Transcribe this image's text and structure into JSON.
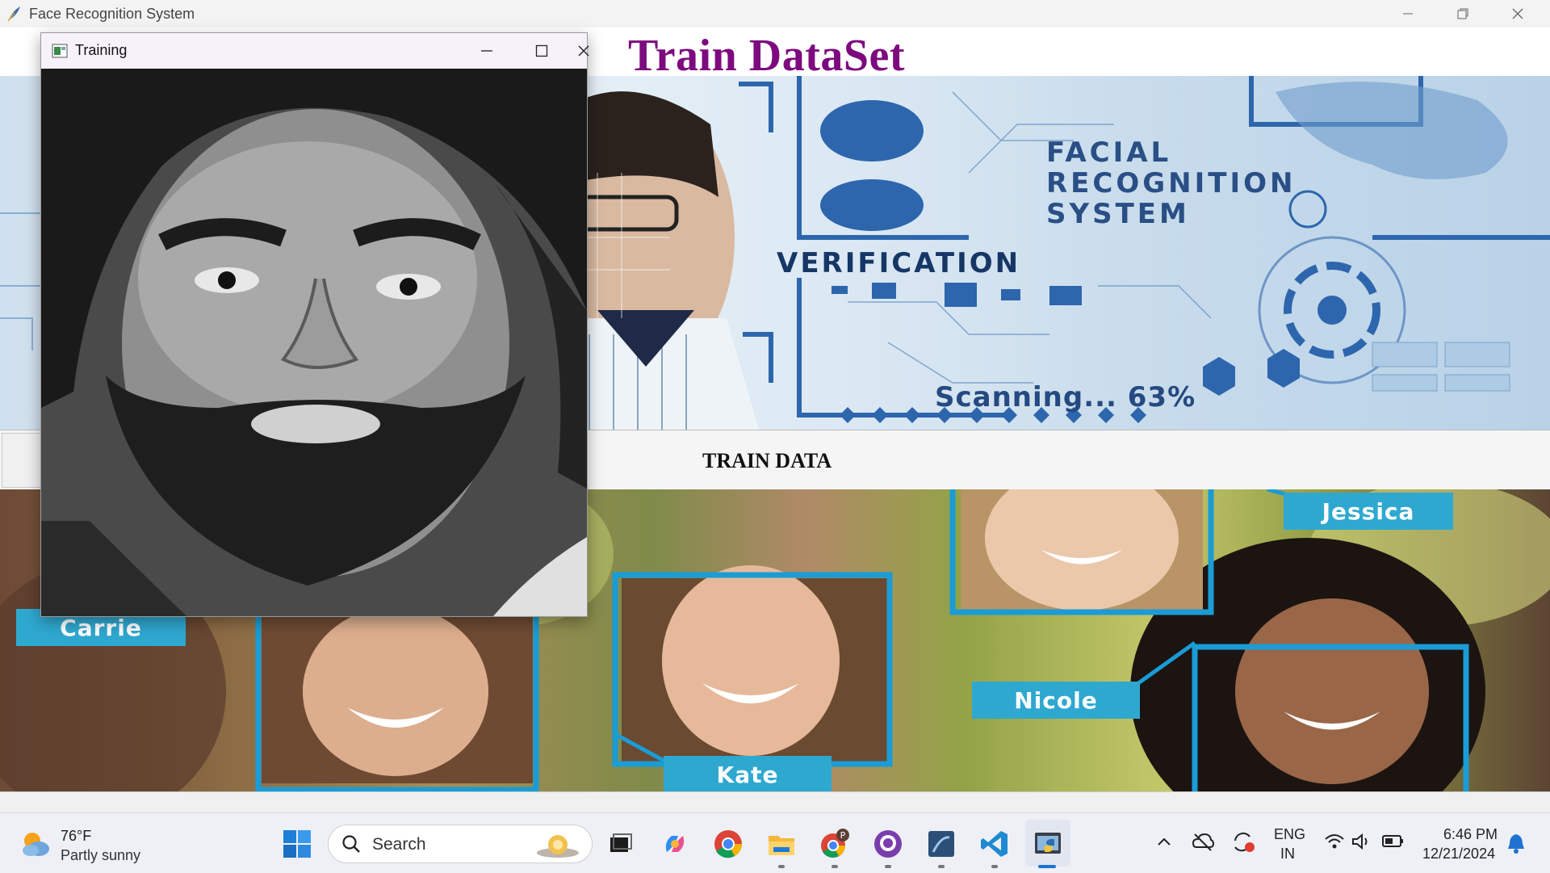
{
  "app": {
    "title": "Face Recognition System",
    "heading": "Train DataSet",
    "train_button": "TRAIN DATA"
  },
  "banner": {
    "line1": "FACIAL",
    "line2": "RECOGNITION",
    "line3": "SYSTEM",
    "verification": "VERIFICATION",
    "scanning": "Scanning... 63%"
  },
  "faces": {
    "names": [
      "Carrie",
      "Kate",
      "Nicole",
      "Jessica"
    ]
  },
  "training_window": {
    "title": "Training"
  },
  "taskbar": {
    "weather_temp": "76°F",
    "weather_cond": "Partly sunny",
    "search_label": "Search",
    "lang_top": "ENG",
    "lang_bottom": "IN",
    "time": "6:46 PM",
    "date": "12/21/2024"
  },
  "colors": {
    "heading": "#7d0a7f",
    "tag": "#2fa8d0",
    "frame": "#1a9cd6"
  }
}
